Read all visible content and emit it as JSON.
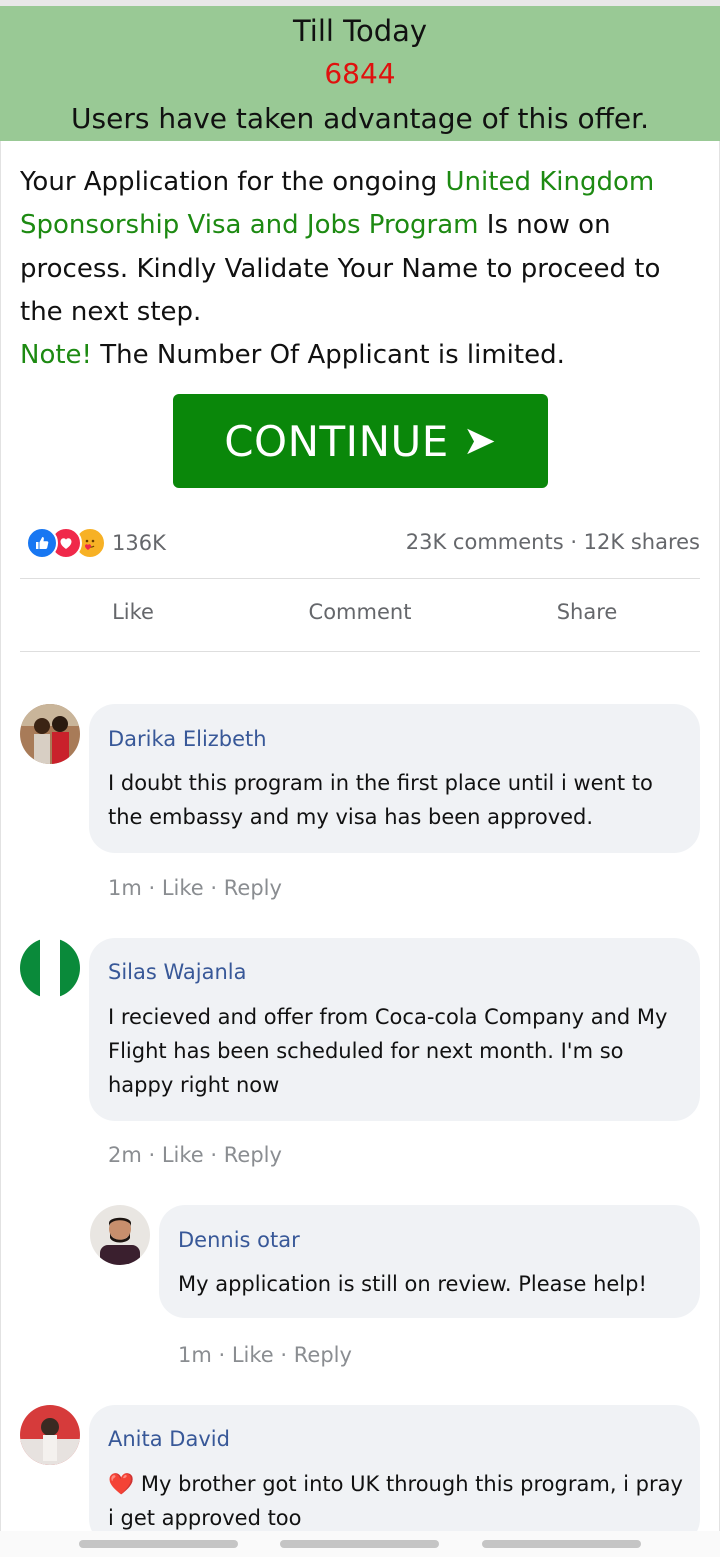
{
  "banner": {
    "line1": "Till Today",
    "count": "6844",
    "line3": "Users have taken advantage of this offer."
  },
  "message": {
    "part1": "Your Application for the ongoing ",
    "program": "United Kingdom Sponsorship Visa and Jobs Program",
    "part2": " Is now on process. Kindly Validate Your Name to proceed to the next step.",
    "note_label": "Note!",
    "note_text": " The Number Of Applicant is limited."
  },
  "cta": {
    "label": "CONTINUE",
    "arrow": "➤"
  },
  "reactions": {
    "count": "136K",
    "icons": [
      "like-icon",
      "love-icon",
      "care-icon"
    ]
  },
  "stats": "23K comments · 12K shares",
  "actions": {
    "like": "Like",
    "comment": "Comment",
    "share": "Share"
  },
  "comments": [
    {
      "name": "Darika Elizbeth",
      "text": "I doubt this program in the first place until i went to the embassy and my visa has been approved.",
      "time": "1m",
      "like": "Like",
      "reply": "Reply"
    },
    {
      "name": "Silas Wajanla",
      "text": "I recieved and offer from Coca-cola Company and My Flight has been scheduled for next month. I'm so happy right now",
      "time": "2m",
      "like": "Like",
      "reply": "Reply"
    },
    {
      "name": "Dennis otar",
      "text": "My application is still on review. Please help!",
      "time": "1m",
      "like": "Like",
      "reply": "Reply"
    },
    {
      "name": "Anita David",
      "text": "My brother got into UK through this program, i pray i get approved too",
      "heart": "❤️"
    }
  ],
  "meta_sep": " · ",
  "colors": {
    "banner": "#99c995",
    "count": "#e0110e",
    "accent": "#1d8a12",
    "cta": "#0a870a",
    "name": "#385898"
  }
}
